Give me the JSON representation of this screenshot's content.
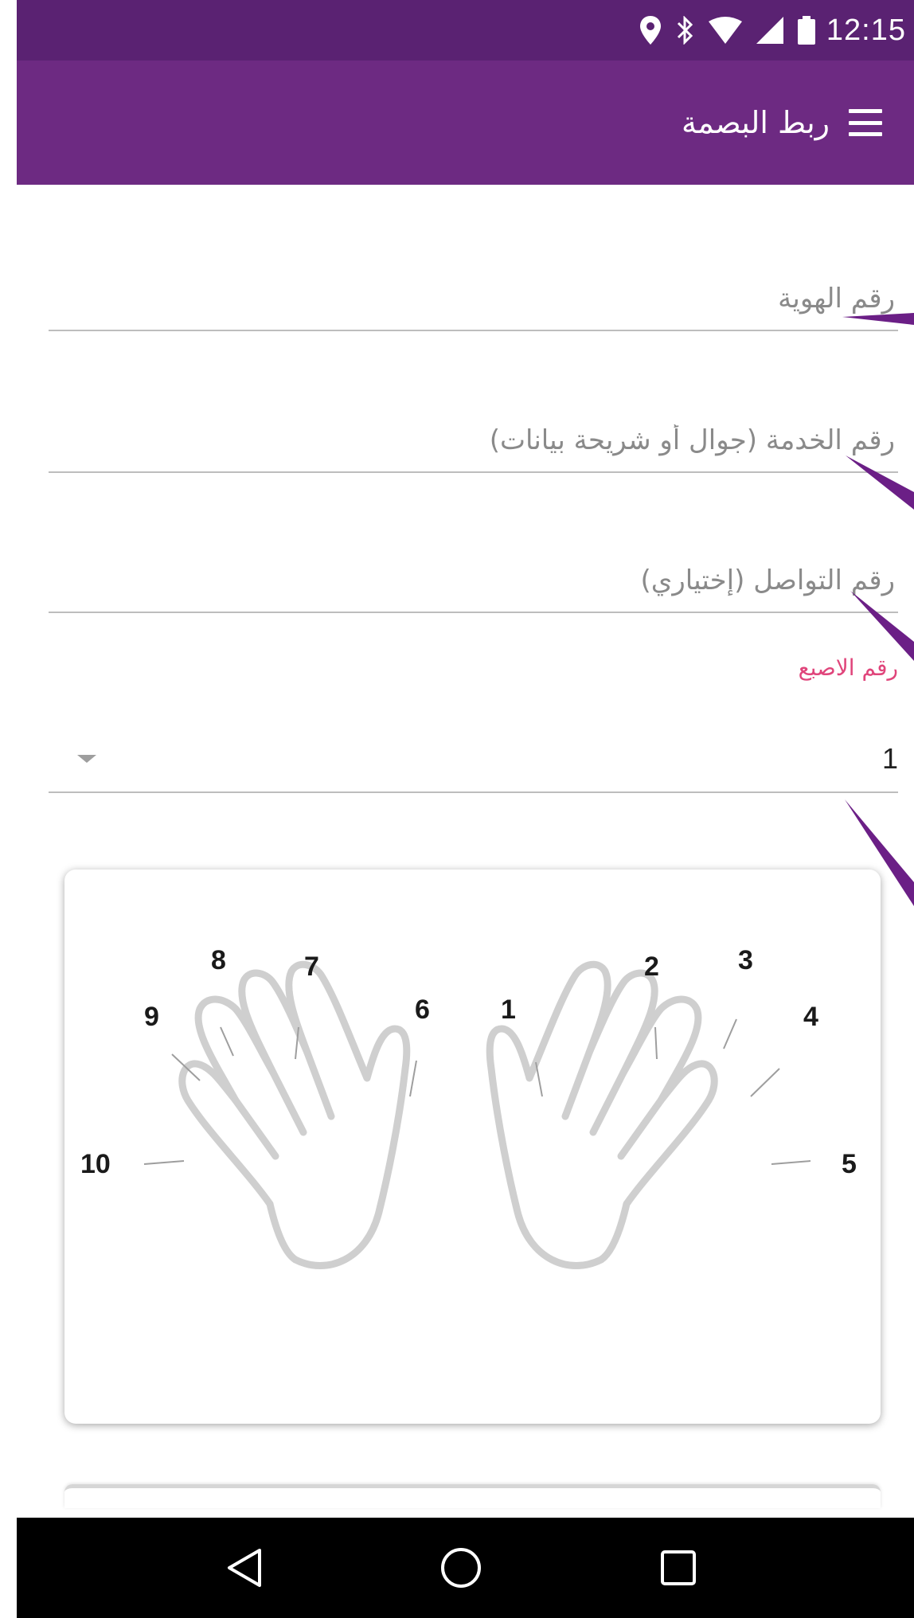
{
  "status_bar": {
    "time": "12:15",
    "icons": [
      "location-icon",
      "bluetooth-icon",
      "wifi-icon",
      "signal-icon",
      "battery-icon"
    ]
  },
  "app_bar": {
    "title": "ربط البصمة",
    "menu_icon": "hamburger-menu-icon",
    "background": "#6d2a82",
    "status_background": "#5a2272"
  },
  "form": {
    "id_number": {
      "placeholder": "رقم الهوية",
      "value": ""
    },
    "service_number": {
      "placeholder": "رقم الخدمة (جوال أو شريحة بيانات)",
      "value": ""
    },
    "contact_number": {
      "placeholder": "رقم التواصل (إختياري)",
      "value": ""
    },
    "finger_select": {
      "label": "رقم الاصبع",
      "value": "1",
      "label_color": "#e0457b"
    }
  },
  "finger_diagram": {
    "right_hand": [
      "1",
      "2",
      "3",
      "4",
      "5"
    ],
    "left_hand": [
      "6",
      "7",
      "8",
      "9",
      "10"
    ]
  },
  "nav_bar": {
    "buttons": [
      "back-icon",
      "home-icon",
      "recents-icon"
    ]
  },
  "annotation_color": "#6b1f86"
}
